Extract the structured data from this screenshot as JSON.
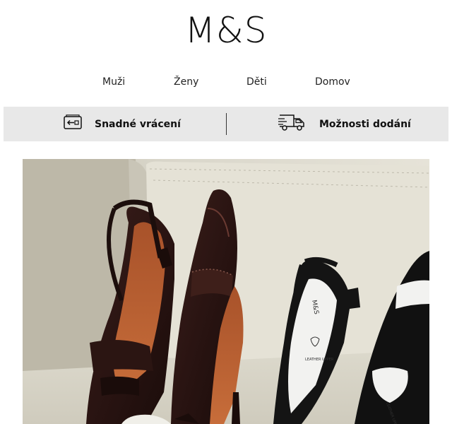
{
  "header": {
    "logo": "M&S"
  },
  "nav": {
    "items": [
      "Muži",
      "Ženy",
      "Děti",
      "Domov"
    ]
  },
  "service_bar": {
    "returns_label": "Snadné vrácení",
    "returns_icon": "return-box-icon",
    "delivery_label": "Možnosti dodání",
    "delivery_icon": "delivery-truck-icon"
  },
  "hero": {
    "image": "shoes-photo",
    "insole_text_1": "LEATHER UPPER",
    "insole_text_2": "M&S",
    "insole_text_3": "LEATHER UPPER"
  },
  "colors": {
    "bar_bg": "#e8e8e8",
    "text": "#111111"
  }
}
